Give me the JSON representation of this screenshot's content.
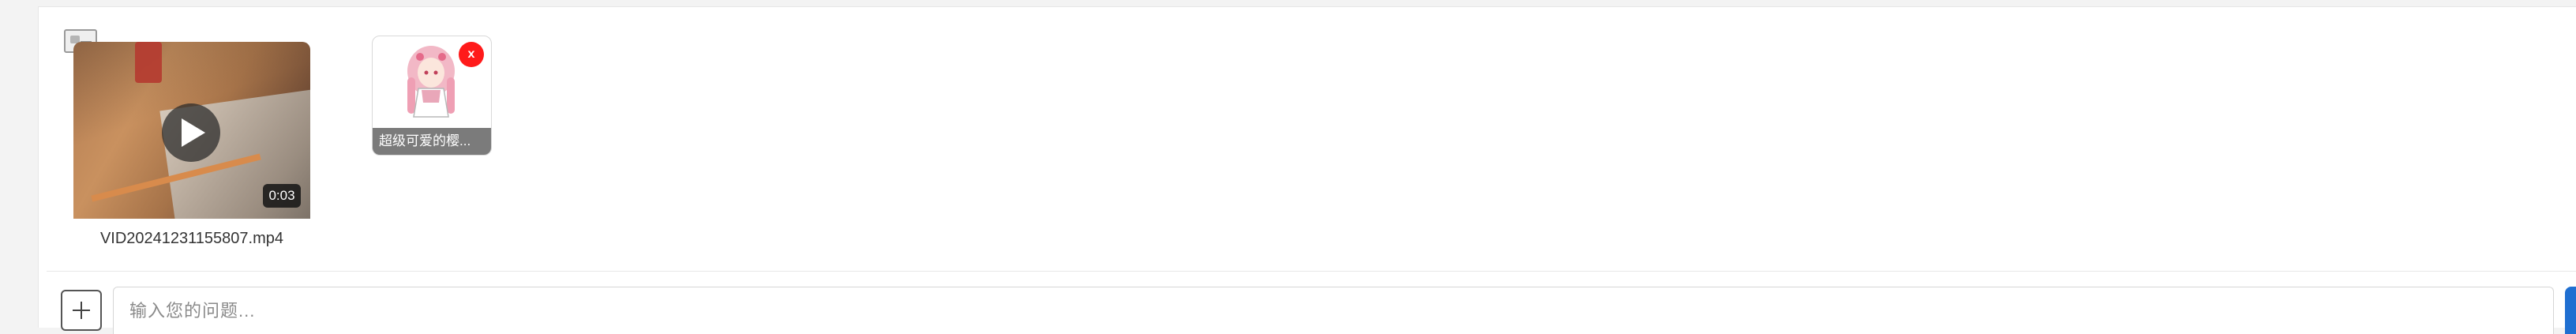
{
  "attachments": {
    "video": {
      "duration": "0:03",
      "filename": "VID20241231155807.mp4",
      "play_icon": "play-icon"
    },
    "image": {
      "caption": "超级可爱的樱...",
      "remove_label": "x",
      "remove_color": "#ff1a1a"
    }
  },
  "composer": {
    "add_icon": "plus-icon",
    "placeholder": "输入您的问题...",
    "value": "",
    "send_color": "#1f6fd1"
  }
}
